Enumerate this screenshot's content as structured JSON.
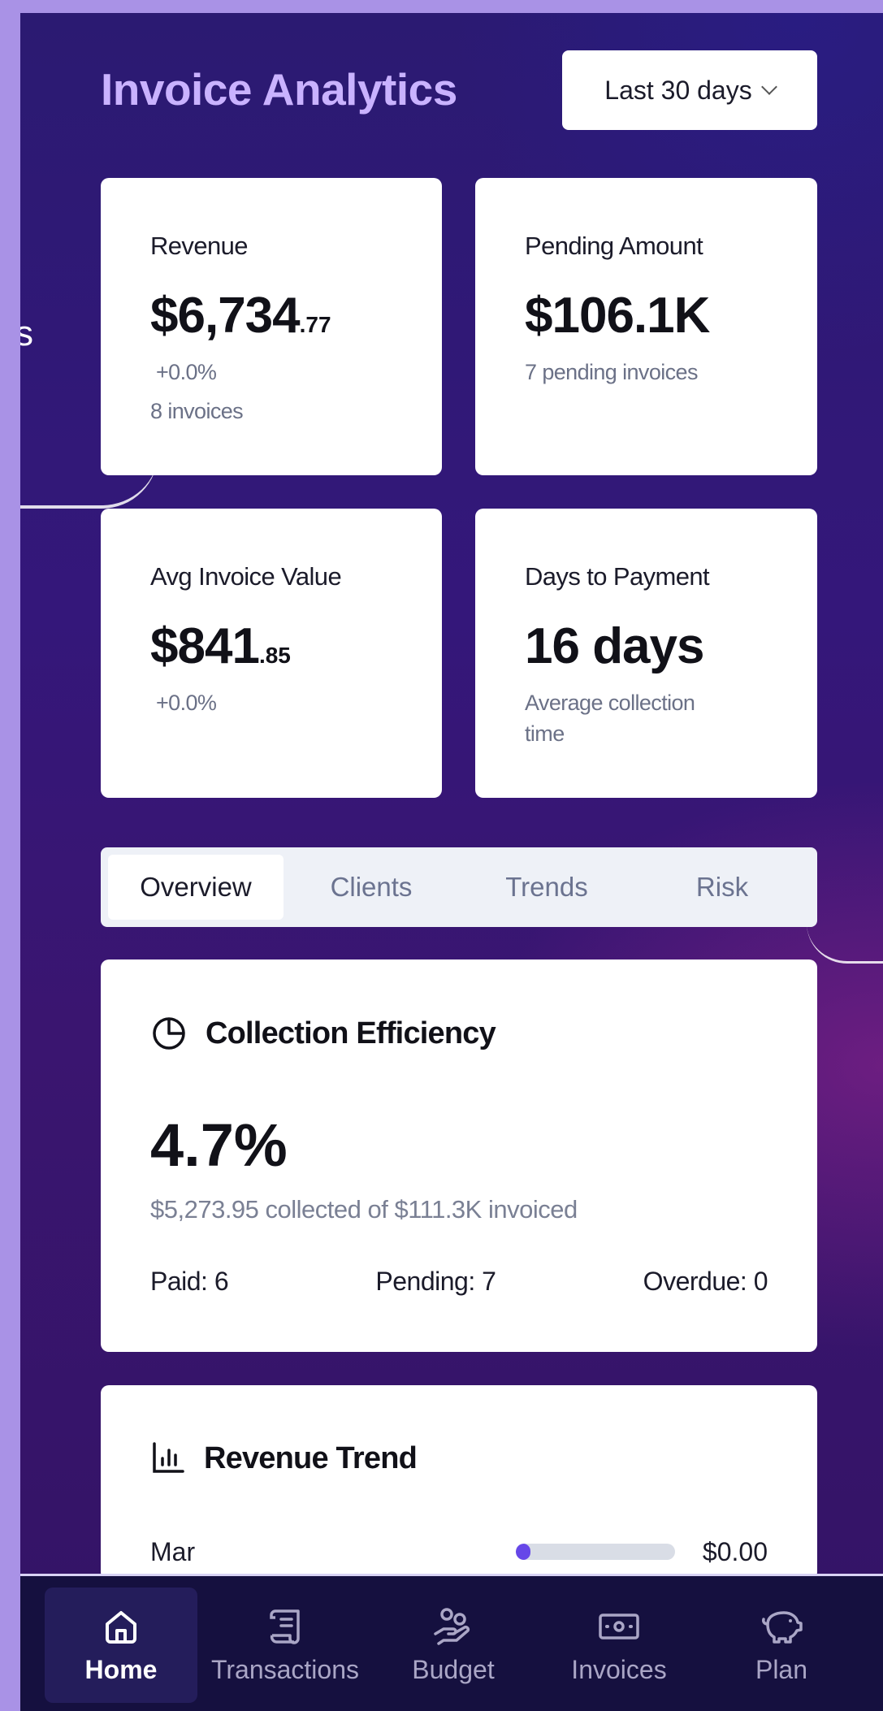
{
  "header": {
    "title": "Invoice Analytics",
    "period": "Last 30 days"
  },
  "left_fragment": "s",
  "kpis": {
    "revenue": {
      "label": "Revenue",
      "value_main": "$6,734",
      "value_cents": ".77",
      "change": "+0.0%",
      "count": "8 invoices"
    },
    "pending": {
      "label": "Pending Amount",
      "value": "$106.1K",
      "sub": "7 pending invoices"
    },
    "avg": {
      "label": "Avg Invoice Value",
      "value_main": "$841",
      "value_cents": ".85",
      "change": "+0.0%"
    },
    "days": {
      "label": "Days to Payment",
      "value": "16 days",
      "sub_line1": "Average collection",
      "sub_line2": "time"
    }
  },
  "tabs": [
    "Overview",
    "Clients",
    "Trends",
    "Risk"
  ],
  "efficiency": {
    "title": "Collection Efficiency",
    "value": "4.7%",
    "sub": "$5,273.95 collected of $111.3K invoiced",
    "paid": "Paid: 6",
    "pending": "Pending: 7",
    "overdue": "Overdue: 0"
  },
  "trend": {
    "title": "Revenue Trend",
    "rows": [
      {
        "month": "Mar",
        "value": "$0.00",
        "fraction": 0
      }
    ]
  },
  "nav": [
    "Home",
    "Transactions",
    "Budget",
    "Invoices",
    "Plan"
  ],
  "colors": {
    "accent": "#6647e8",
    "title": "#c9b2ff",
    "nav_bg": "#15103f"
  }
}
